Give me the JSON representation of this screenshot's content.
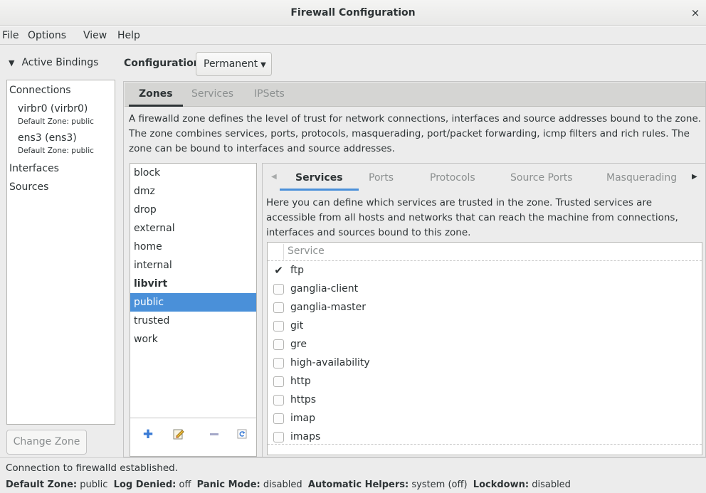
{
  "window": {
    "title": "Firewall Configuration",
    "close_glyph": "×"
  },
  "menu": [
    "File",
    "Options",
    "View",
    "Help"
  ],
  "left_pane": {
    "toggle_label": "Active Bindings",
    "connections_header": "Connections",
    "connections": [
      {
        "name": "virbr0 (virbr0)",
        "zone": "Default Zone: public"
      },
      {
        "name": "ens3 (ens3)",
        "zone": "Default Zone: public"
      }
    ],
    "interfaces_header": "Interfaces",
    "sources_header": "Sources",
    "change_zone_button": "Change Zone"
  },
  "configuration": {
    "label": "Configuration:",
    "value": "Permanent"
  },
  "top_tabs": [
    {
      "label": "Zones",
      "active": true
    },
    {
      "label": "Services",
      "active": false
    },
    {
      "label": "IPSets",
      "active": false
    }
  ],
  "zone_description": "A firewalld zone defines the level of trust for network connections, interfaces and source addresses bound to the zone. The zone combines services, ports, protocols, masquerading, port/packet forwarding, icmp filters and rich rules. The zone can be bound to interfaces and source addresses.",
  "zones": [
    {
      "name": "block"
    },
    {
      "name": "dmz"
    },
    {
      "name": "drop"
    },
    {
      "name": "external"
    },
    {
      "name": "home"
    },
    {
      "name": "internal"
    },
    {
      "name": "libvirt",
      "bold": true
    },
    {
      "name": "public",
      "selected": true
    },
    {
      "name": "trusted"
    },
    {
      "name": "work"
    }
  ],
  "zone_toolbar": [
    "add-icon",
    "edit-icon",
    "remove-icon",
    "load-defaults-icon"
  ],
  "sub_tabs": [
    {
      "label": "Services",
      "active": true
    },
    {
      "label": "Ports",
      "active": false
    },
    {
      "label": "Protocols",
      "active": false
    },
    {
      "label": "Source Ports",
      "active": false
    },
    {
      "label": "Masquerading",
      "active": false
    }
  ],
  "services_description": "Here you can define which services are trusted in the zone. Trusted services are accessible from all hosts and networks that can reach the machine from connections, interfaces and sources bound to this zone.",
  "services_table": {
    "header": "Service",
    "rows": [
      {
        "name": "ftp",
        "checked": true
      },
      {
        "name": "ganglia-client",
        "checked": false
      },
      {
        "name": "ganglia-master",
        "checked": false
      },
      {
        "name": "git",
        "checked": false
      },
      {
        "name": "gre",
        "checked": false
      },
      {
        "name": "high-availability",
        "checked": false
      },
      {
        "name": "http",
        "checked": false
      },
      {
        "name": "https",
        "checked": false
      },
      {
        "name": "imap",
        "checked": false
      },
      {
        "name": "imaps",
        "checked": false
      }
    ]
  },
  "status": {
    "message": "Connection to firewalld established.",
    "default_zone_label": "Default Zone:",
    "default_zone": "public",
    "log_denied_label": "Log Denied:",
    "log_denied": "off",
    "panic_mode_label": "Panic Mode:",
    "panic_mode": "disabled",
    "auto_helpers_label": "Automatic Helpers:",
    "auto_helpers": "system (off)",
    "lockdown_label": "Lockdown:",
    "lockdown": "disabled"
  },
  "colors": {
    "selection": "#4a90d9",
    "window_bg": "#ececec",
    "tab_bar": "#d5d5d3"
  }
}
